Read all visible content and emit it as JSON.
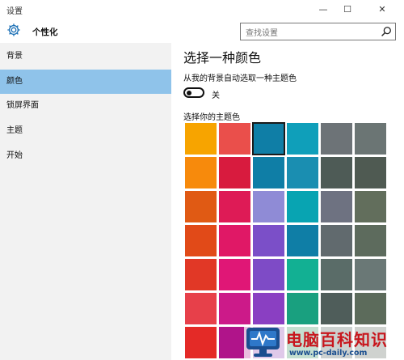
{
  "window": {
    "title": "设置",
    "minimize_icon": "—",
    "maximize_icon": "☐",
    "close_icon": "✕"
  },
  "sidebar": {
    "title": "个性化",
    "items": [
      {
        "label": "背景",
        "selected": false
      },
      {
        "label": "颜色",
        "selected": true
      },
      {
        "label": "锁屏界面",
        "selected": false
      },
      {
        "label": "主题",
        "selected": false
      },
      {
        "label": "开始",
        "selected": false
      }
    ]
  },
  "search": {
    "placeholder": "查找设置"
  },
  "main": {
    "heading": "选择一种颜色",
    "auto_label": "从我的背景自动选取一种主题色",
    "toggle_state": "关",
    "toggle_on": false,
    "grid_label": "选择你的主题色",
    "selected_swatch": [
      0,
      2
    ],
    "swatch_rows": [
      [
        "#f7a400",
        "#ea4f4b",
        "#0f7ea6",
        "#0f9fba",
        "#6d7377",
        "#6b7574"
      ],
      [
        "#f78a0c",
        "#d81b3e",
        "#0f7ea6",
        "#1a8eb1",
        "#4e5b56",
        "#4f5a52"
      ],
      [
        "#e05a14",
        "#de1b56",
        "#8f8bd6",
        "#08a4b2",
        "#6e7281",
        "#626e5c"
      ],
      [
        "#e14a18",
        "#e01866",
        "#7b4fc8",
        "#0f7ea6",
        "#616a6e",
        "#5d6b5d"
      ],
      [
        "#e13826",
        "#e01776",
        "#7e4bc6",
        "#12b093",
        "#5a6c68",
        "#6a7876"
      ],
      [
        "#e7404a",
        "#cc1a89",
        "#8a3fc2",
        "#19a07f",
        "#4f5d5a",
        "#5c6b5b"
      ],
      [
        "#e42a27",
        "#b0148a",
        "#8c3fb0",
        "#2c8d58",
        "#4a5b56",
        "#545e54"
      ]
    ]
  },
  "watermark": {
    "title": "电脑百科知识",
    "url": "www.pc-daily.com"
  }
}
